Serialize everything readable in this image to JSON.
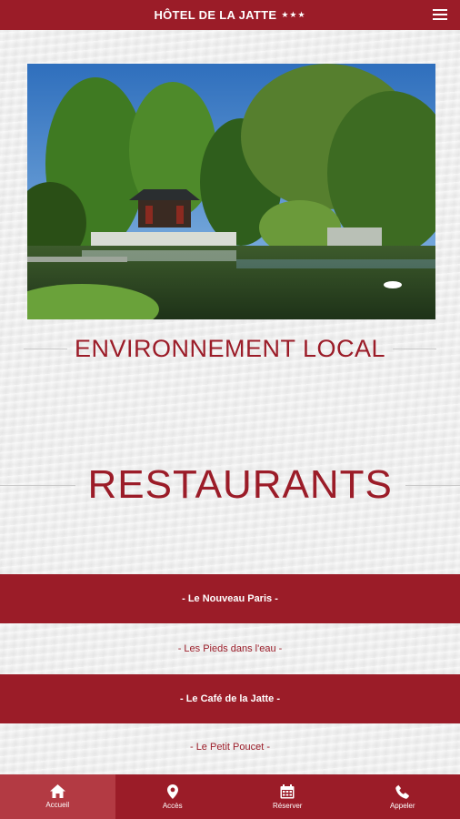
{
  "header": {
    "title": "HÔTEL DE LA JATTE",
    "stars": "★★★",
    "menu_icon": "hamburger-menu-icon"
  },
  "hero": {
    "image": "park-pond-with-pavilion-photo"
  },
  "environment": {
    "heading": "ENVIRONNEMENT LOCAL"
  },
  "restaurants": {
    "heading": "RESTAURANTS",
    "items": [
      {
        "label": "- Le Nouveau Paris -"
      },
      {
        "label": "- Les Pieds dans l'eau -"
      },
      {
        "label": "- Le Café de la Jatte -"
      },
      {
        "label": "- Le Petit Poucet -"
      }
    ]
  },
  "bottom_nav": {
    "items": [
      {
        "label": "Accueil",
        "icon": "home-icon"
      },
      {
        "label": "Accès",
        "icon": "map-pin-icon"
      },
      {
        "label": "Réserver",
        "icon": "calendar-icon"
      },
      {
        "label": "Appeler",
        "icon": "phone-icon"
      }
    ]
  },
  "colors": {
    "brand": "#9b1c28",
    "nav_active": "#b33a43",
    "background": "#efefef"
  }
}
